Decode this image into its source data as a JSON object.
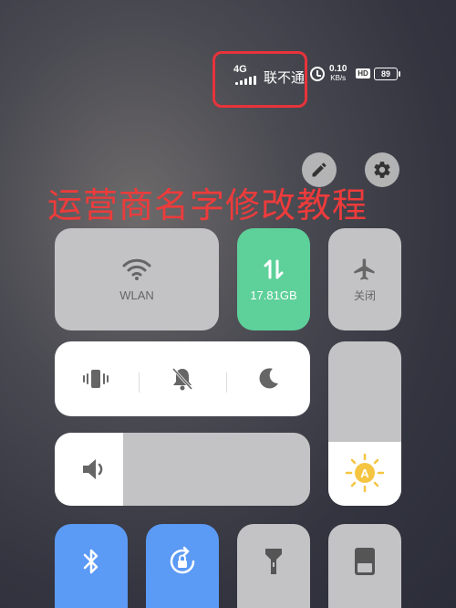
{
  "status_bar": {
    "network_type": "4G",
    "carrier": "联不通",
    "speed_value": "0.10",
    "speed_unit": "KB/s",
    "hd_badge": "HD",
    "battery": "89"
  },
  "headline": "运营商名字修改教程",
  "tiles": {
    "wlan_label": "WLAN",
    "data_usage": "17.81GB",
    "airplane_label": "关闭"
  },
  "colors": {
    "accent_green": "#5ed09a",
    "accent_blue": "#5b9af5",
    "annotation_red": "#e8333a"
  },
  "icons": [
    "edit-icon",
    "settings-icon",
    "wifi-icon",
    "data-arrows-icon",
    "airplane-icon",
    "vibrate-icon",
    "mute-bell-icon",
    "moon-icon",
    "volume-icon",
    "brightness-sun-icon",
    "bluetooth-icon",
    "rotation-lock-icon",
    "flashlight-icon",
    "screen-icon"
  ]
}
